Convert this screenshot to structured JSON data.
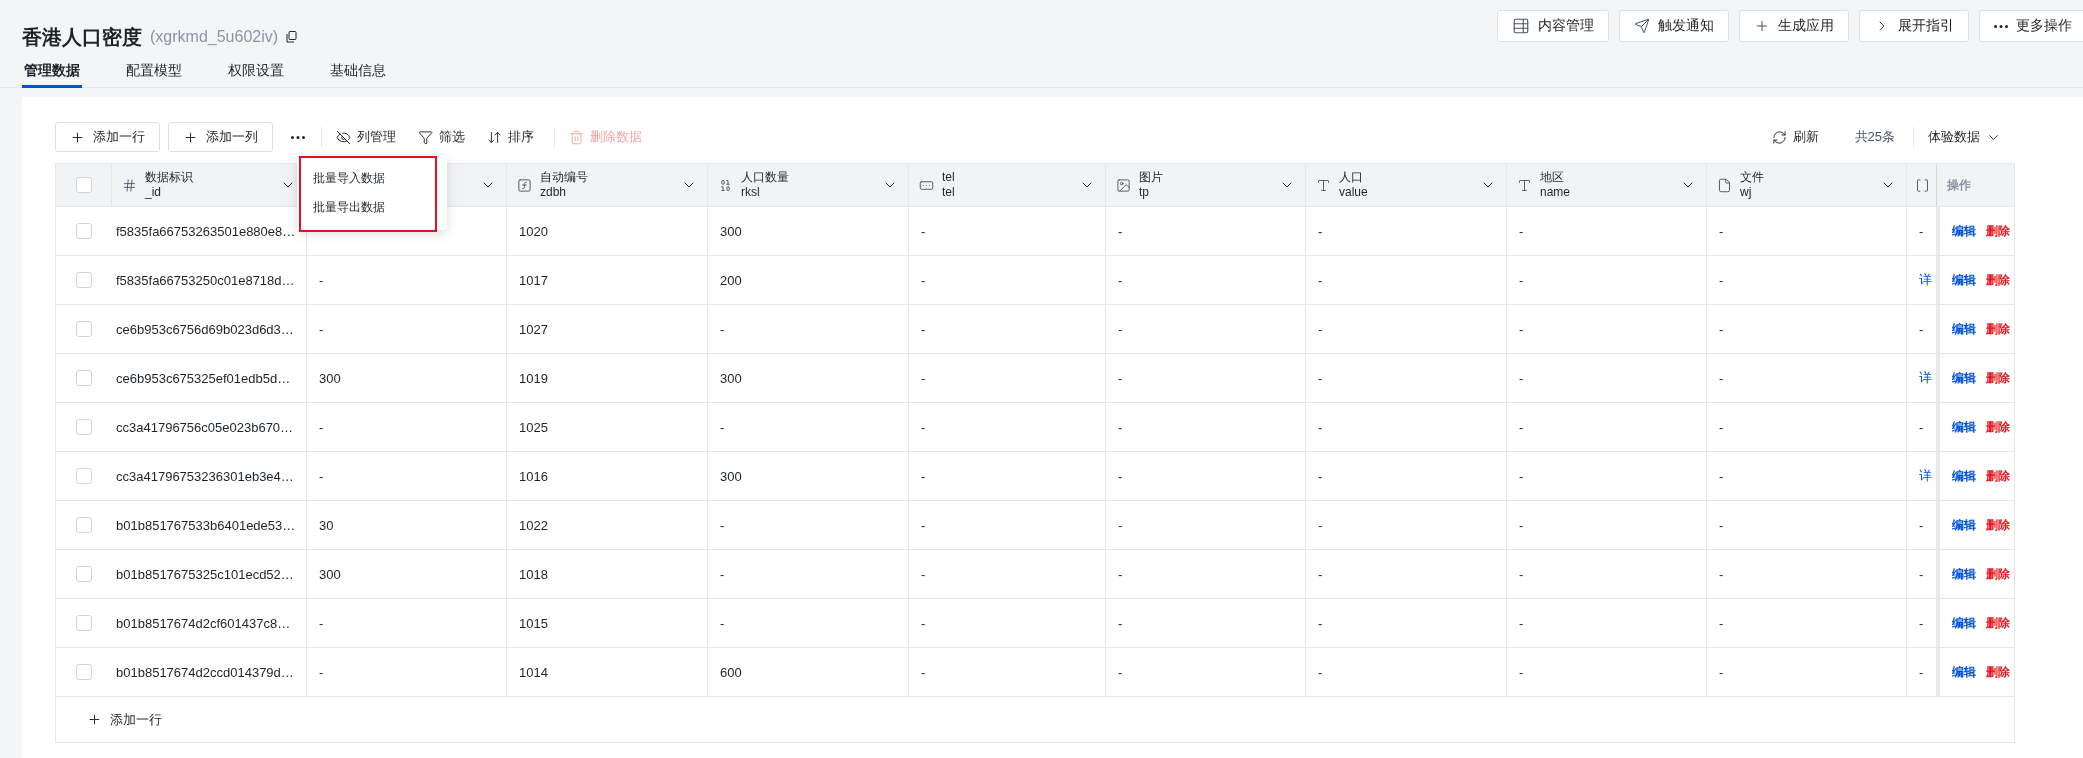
{
  "header": {
    "title": "香港人口密度",
    "code": "(xgrkmd_5u602iv)",
    "actions": [
      {
        "kind": "table",
        "label": "内容管理"
      },
      {
        "kind": "send",
        "label": "触发通知"
      },
      {
        "kind": "plus",
        "label": "生成应用"
      },
      {
        "kind": "next",
        "label": "展开指引"
      },
      {
        "kind": "more",
        "label": "更多操作"
      }
    ]
  },
  "tabs": [
    {
      "label": "管理数据",
      "selected": true
    },
    {
      "label": "配置模型",
      "selected": false
    },
    {
      "label": "权限设置",
      "selected": false
    },
    {
      "label": "基础信息",
      "selected": false
    }
  ],
  "toolbar": {
    "add_buttons": [
      "添加一行",
      "添加一列"
    ],
    "tools": [
      {
        "kind": "columns",
        "label": "列管理",
        "disabled": false
      },
      {
        "kind": "filter",
        "label": "筛选",
        "disabled": false
      },
      {
        "kind": "sort",
        "label": "排序",
        "disabled": false
      },
      {
        "kind": "delete",
        "label": "删除数据",
        "disabled": true
      }
    ],
    "refresh": "刷新",
    "count": "共25条",
    "dataset": "体验数据"
  },
  "menu": {
    "items": [
      "批量导入数据",
      "批量导出数据"
    ],
    "highlighted": true
  },
  "table": {
    "columns": [
      {
        "kind": "id",
        "label": "数据标识",
        "field": "_id"
      },
      {
        "kind": "hidden"
      },
      {
        "kind": "formula",
        "label": "自动编号",
        "field": "zdbh"
      },
      {
        "kind": "number",
        "label": "人口数量",
        "field": "rksl"
      },
      {
        "kind": "phone",
        "label": "tel",
        "field": "tel"
      },
      {
        "kind": "image",
        "label": "图片",
        "field": "tp"
      },
      {
        "kind": "text",
        "label": "人口",
        "field": "value"
      },
      {
        "kind": "text",
        "label": "地区",
        "field": "name"
      },
      {
        "kind": "file",
        "label": "文件",
        "field": "wj"
      },
      {
        "kind": "array"
      }
    ],
    "actions_header": "操作",
    "select_all": false,
    "rows": [
      {
        "checked": false,
        "cells": [
          "f5835fa66753263501e880e8…",
          null,
          "1020",
          "300",
          "-",
          "-",
          "-",
          "-",
          "-",
          "-"
        ],
        "actions": [
          "编辑",
          "删除"
        ]
      },
      {
        "checked": false,
        "cells": [
          "f5835fa66753250c01e8718d…",
          "-",
          "1017",
          "200",
          "-",
          "-",
          "-",
          "-",
          "-",
          "详"
        ],
        "actions": [
          "编辑",
          "删除"
        ]
      },
      {
        "checked": false,
        "cells": [
          "ce6b953c6756d69b023d6d3…",
          "-",
          "1027",
          "-",
          "-",
          "-",
          "-",
          "-",
          "-",
          "-"
        ],
        "actions": [
          "编辑",
          "删除"
        ]
      },
      {
        "checked": false,
        "cells": [
          "ce6b953c675325ef01edb5d…",
          "300",
          "1019",
          "300",
          "-",
          "-",
          "-",
          "-",
          "-",
          "详"
        ],
        "actions": [
          "编辑",
          "删除"
        ]
      },
      {
        "checked": false,
        "cells": [
          "cc3a41796756c05e023b670…",
          "-",
          "1025",
          "-",
          "-",
          "-",
          "-",
          "-",
          "-",
          "-"
        ],
        "actions": [
          "编辑",
          "删除"
        ]
      },
      {
        "checked": false,
        "cells": [
          "cc3a41796753236301eb3e4…",
          "-",
          "1016",
          "300",
          "-",
          "-",
          "-",
          "-",
          "-",
          "详"
        ],
        "actions": [
          "编辑",
          "删除"
        ]
      },
      {
        "checked": false,
        "cells": [
          "b01b851767533b6401ede53…",
          "30",
          "1022",
          "-",
          "-",
          "-",
          "-",
          "-",
          "-",
          "-"
        ],
        "actions": [
          "编辑",
          "删除"
        ]
      },
      {
        "checked": false,
        "cells": [
          "b01b8517675325c101ecd52…",
          "300",
          "1018",
          "-",
          "-",
          "-",
          "-",
          "-",
          "-",
          "-"
        ],
        "actions": [
          "编辑",
          "删除"
        ]
      },
      {
        "checked": false,
        "cells": [
          "b01b8517674d2cf601437c8…",
          "-",
          "1015",
          "-",
          "-",
          "-",
          "-",
          "-",
          "-",
          "-"
        ],
        "actions": [
          "编辑",
          "删除"
        ]
      },
      {
        "checked": false,
        "cells": [
          "b01b8517674d2ccd014379d…",
          "-",
          "1014",
          "600",
          "-",
          "-",
          "-",
          "-",
          "-",
          "-"
        ],
        "actions": [
          "编辑",
          "删除"
        ]
      }
    ],
    "add_row": "添加一行"
  }
}
